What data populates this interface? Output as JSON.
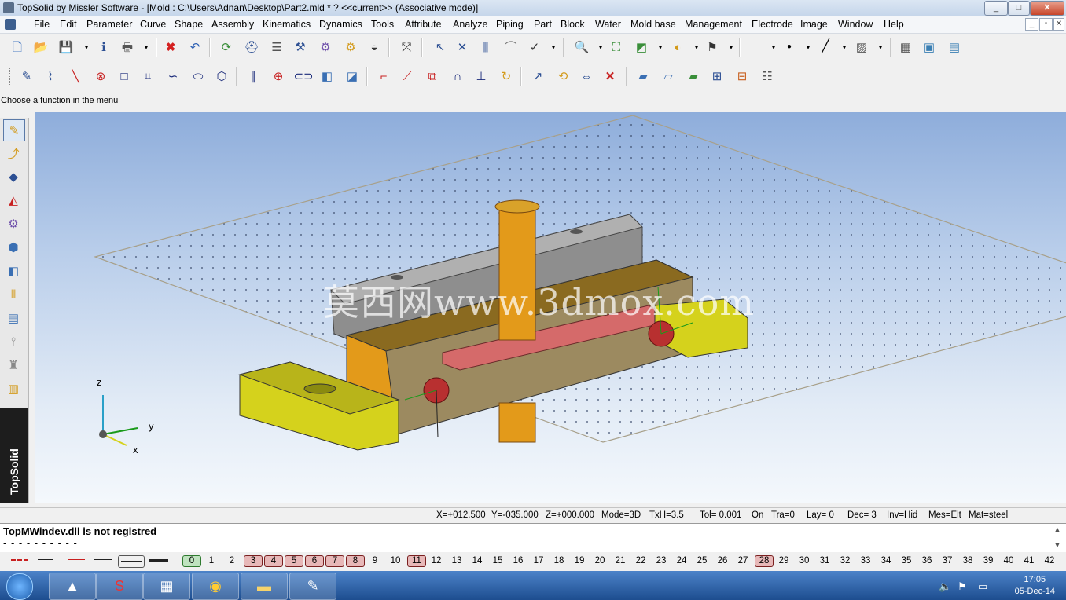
{
  "window": {
    "title": "TopSolid by Missler Software - [Mold : C:\\Users\\Adnan\\Desktop\\Part2.mld * ?  <<current>> (Associative mode)]",
    "min": "_",
    "max": "□",
    "close": "✕"
  },
  "menu": [
    "File",
    "Edit",
    "Parameter",
    "Curve",
    "Shape",
    "Assembly",
    "Kinematics",
    "Dynamics",
    "Tools",
    "Attribute",
    "Analyze",
    "Piping",
    "Part",
    "Block",
    "Water",
    "Mold base",
    "Management",
    "Electrode",
    "Image",
    "Window",
    "Help"
  ],
  "mdi": {
    "min": "_",
    "restore": "▫",
    "close": "✕"
  },
  "hint": "Choose a function in the menu",
  "viewport": {
    "watermark": "莫西网www.3dmox.com",
    "triad": {
      "z": "z",
      "y": "y",
      "x": "x"
    }
  },
  "status": {
    "x": "X=+012.500",
    "y": "Y=-035.000",
    "z": "Z=+000.000",
    "mode": "Mode=3D",
    "txh": "TxH=3.5",
    "tol": "Tol= 0.001",
    "on": "On",
    "tra": "Tra=0",
    "lay": "Lay=  0",
    "dec": "Dec= 3",
    "inv": "Inv=Hid",
    "mes": "Mes=Elt",
    "mat": "Mat=steel"
  },
  "messages": {
    "line1": "TopMWindev.dll is not registred",
    "line2": "- - - - - - - - - -"
  },
  "layers": {
    "current": "0",
    "numbers": [
      "0",
      "1",
      "2",
      "3",
      "4",
      "5",
      "6",
      "7",
      "8",
      "9",
      "10",
      "11",
      "12",
      "13",
      "14",
      "15",
      "16",
      "17",
      "18",
      "19",
      "20",
      "21",
      "22",
      "23",
      "24",
      "25",
      "26",
      "27",
      "28",
      "29",
      "30",
      "31",
      "32",
      "33",
      "34",
      "35",
      "36",
      "37",
      "38",
      "39",
      "40",
      "41",
      "42"
    ],
    "used": [
      "3",
      "4",
      "5",
      "6",
      "7",
      "8",
      "11",
      "28"
    ]
  },
  "palette_brand": "TopSolid",
  "clock": {
    "time": "17:05",
    "date": "05-Dec-14"
  },
  "colors": {
    "accent_red": "#e25c5c",
    "part_yellow": "#d5d21c",
    "part_orange": "#e39a1a",
    "pad_red": "#d56a6a"
  }
}
